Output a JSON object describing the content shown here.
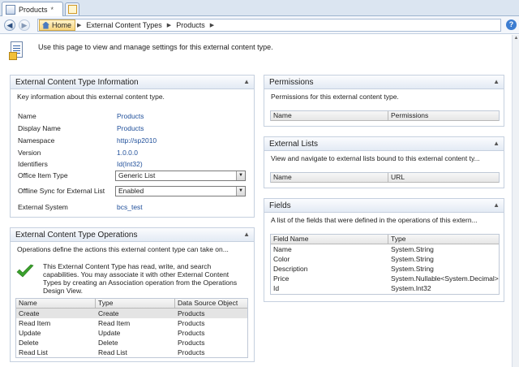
{
  "tab": {
    "label": "Products",
    "modified": "*"
  },
  "breadcrumb": {
    "home": "Home",
    "items": [
      "External Content Types",
      "Products"
    ]
  },
  "intro": "Use this page to view and manage settings for this external content type.",
  "info_panel": {
    "title": "External Content Type Information",
    "description": "Key information about this external content type.",
    "fields": [
      {
        "label": "Name",
        "value": "Products"
      },
      {
        "label": "Display Name",
        "value": "Products"
      },
      {
        "label": "Namespace",
        "value": "http://sp2010"
      },
      {
        "label": "Version",
        "value": "1.0.0.0"
      },
      {
        "label": "Identifiers",
        "value": "Id(Int32)"
      }
    ],
    "office_item_type": {
      "label": "Office Item Type",
      "value": "Generic List"
    },
    "offline_sync": {
      "label": "Offline Sync for External List",
      "value": "Enabled"
    },
    "external_system": {
      "label": "External System",
      "value": "bcs_test"
    }
  },
  "operations_panel": {
    "title": "External Content Type Operations",
    "description": "Operations define the actions this external content type can take on...",
    "message": "This External Content Type has read, write, and search capabilities. You may associate it with other External Content Types by creating an Association operation from the Operations Design View.",
    "columns": [
      "Name",
      "Type",
      "Data Source Object"
    ],
    "rows": [
      [
        "Create",
        "Create",
        "Products"
      ],
      [
        "Read Item",
        "Read Item",
        "Products"
      ],
      [
        "Update",
        "Update",
        "Products"
      ],
      [
        "Delete",
        "Delete",
        "Products"
      ],
      [
        "Read List",
        "Read List",
        "Products"
      ]
    ]
  },
  "permissions_panel": {
    "title": "Permissions",
    "description": "Permissions for this external content type.",
    "columns": [
      "Name",
      "Permissions"
    ]
  },
  "lists_panel": {
    "title": "External Lists",
    "description": "View and navigate to external lists bound to this external content ty...",
    "columns": [
      "Name",
      "URL"
    ]
  },
  "fields_panel": {
    "title": "Fields",
    "description": "A list of the fields that were defined in the operations of this extern...",
    "columns": [
      "Field Name",
      "Type"
    ],
    "rows": [
      [
        "Name",
        "System.String"
      ],
      [
        "Color",
        "System.String"
      ],
      [
        "Description",
        "System.String"
      ],
      [
        "Price",
        "System.Nullable<System.Decimal>"
      ],
      [
        "Id",
        "System.Int32"
      ]
    ]
  },
  "icons": {
    "back": "back-arrow-icon",
    "forward": "forward-arrow-icon",
    "home": "home-icon",
    "help": "help-icon",
    "collapse": "chevron-up-icon",
    "dropdown": "chevron-down-icon",
    "check": "checkmark-icon"
  },
  "colors": {
    "link": "#1f4f9a",
    "panel_border": "#c5d0df",
    "selected_row": "#e4e4e4",
    "check": "#3aa12c"
  }
}
